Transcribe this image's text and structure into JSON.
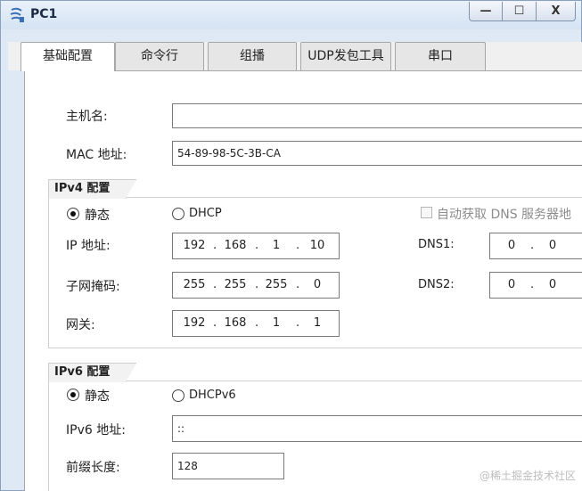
{
  "window": {
    "title": "PC1",
    "minimize_glyph": "—",
    "maximize_glyph": "☐",
    "close_glyph": "X"
  },
  "tabs": [
    {
      "label": "基础配置",
      "active": true
    },
    {
      "label": "命令行",
      "active": false
    },
    {
      "label": "组播",
      "active": false
    },
    {
      "label": "UDP发包工具",
      "active": false
    },
    {
      "label": "串口",
      "active": false
    }
  ],
  "basic": {
    "hostname_label": "主机名:",
    "hostname_value": "",
    "mac_label": "MAC 地址:",
    "mac_value": "54-89-98-5C-3B-CA"
  },
  "ipv4": {
    "group_title": "IPv4 配置",
    "static_label": "静态",
    "dhcp_label": "DHCP",
    "auto_dns_label": "自动获取 DNS 服务器地",
    "ip_label": "IP 地址:",
    "ip_octets": [
      "192",
      "168",
      "1",
      "10"
    ],
    "mask_label": "子网掩码:",
    "mask_octets": [
      "255",
      "255",
      "255",
      "0"
    ],
    "gateway_label": "网关:",
    "gateway_octets": [
      "192",
      "168",
      "1",
      "1"
    ],
    "dns1_label": "DNS1:",
    "dns1_octets": [
      "0",
      "0"
    ],
    "dns2_label": "DNS2:",
    "dns2_octets": [
      "0",
      "0"
    ]
  },
  "ipv6": {
    "group_title": "IPv6 配置",
    "static_label": "静态",
    "dhcp_label": "DHCPv6",
    "ip_label": "IPv6 地址:",
    "ip_value": "::",
    "prefix_label": "前缀长度:",
    "prefix_value": "128"
  },
  "watermark": "@稀土掘金技术社区"
}
